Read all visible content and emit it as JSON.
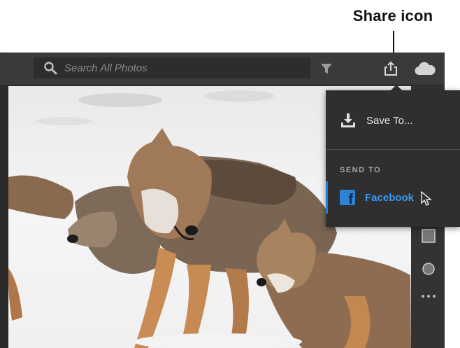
{
  "callout": {
    "label": "Share icon"
  },
  "toolbar": {
    "search_placeholder": "Search All Photos",
    "icons": [
      "search-icon",
      "filter-icon",
      "share-icon",
      "cloud-icon"
    ]
  },
  "share_menu": {
    "save_label": "Save To...",
    "section_heading": "SEND TO",
    "facebook_label": "Facebook",
    "icons": [
      "download-icon",
      "facebook-icon"
    ]
  },
  "rightbar": {
    "icons": [
      "square-icon",
      "circle-icon",
      "more-icon"
    ]
  },
  "photo": {
    "subject": ""
  },
  "colors": {
    "accent": "#1e7fd8",
    "link": "#3a9af0",
    "toolbar_bg": "#3a3a3a",
    "menu_bg": "#2f2f2f"
  }
}
